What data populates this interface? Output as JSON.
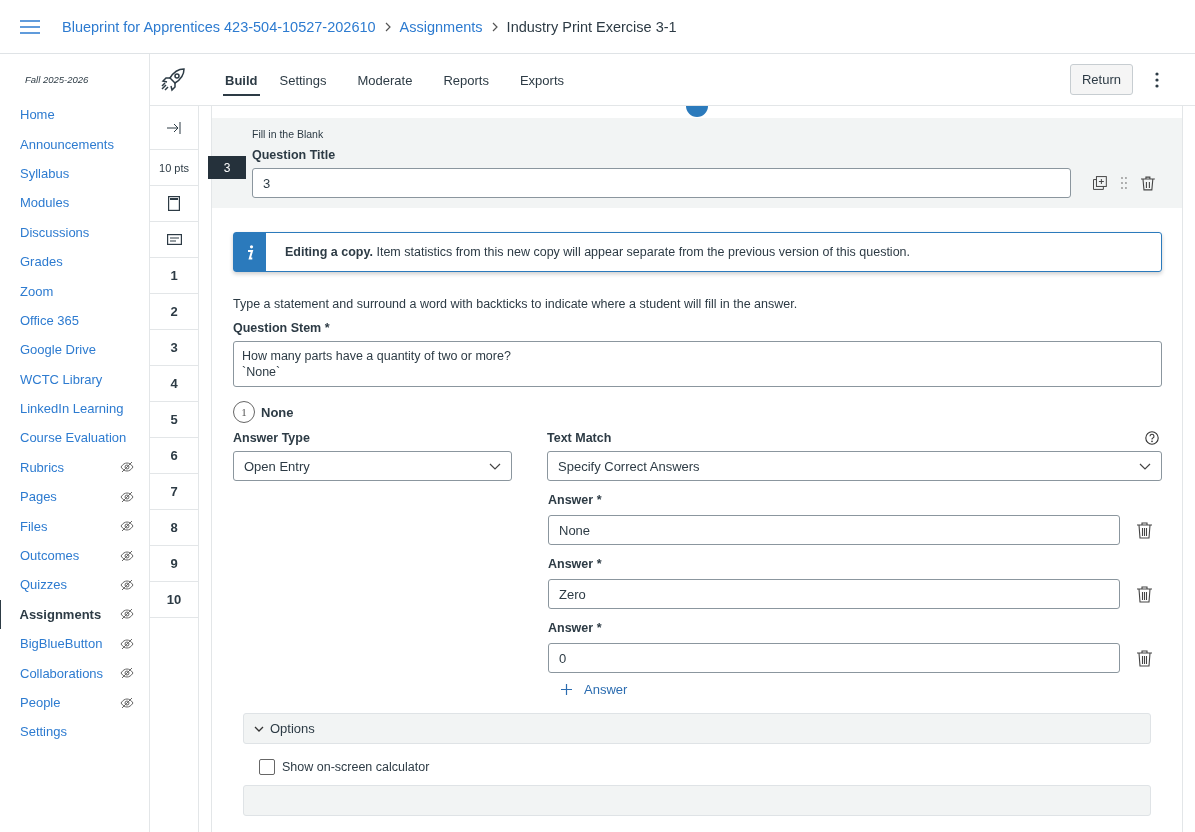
{
  "header": {
    "breadcrumbs": [
      {
        "label": "Blueprint for Apprentices 423-504-10527-202610",
        "kind": "link"
      },
      {
        "label": "Assignments",
        "kind": "link"
      },
      {
        "label": "Industry Print Exercise 3-1",
        "kind": "current"
      }
    ]
  },
  "sidebar": {
    "term": "Fall 2025-2026",
    "items": [
      {
        "label": "Home",
        "hidden": false,
        "selected": false
      },
      {
        "label": "Announcements",
        "hidden": false,
        "selected": false
      },
      {
        "label": "Syllabus",
        "hidden": false,
        "selected": false
      },
      {
        "label": "Modules",
        "hidden": false,
        "selected": false
      },
      {
        "label": "Discussions",
        "hidden": false,
        "selected": false
      },
      {
        "label": "Grades",
        "hidden": false,
        "selected": false
      },
      {
        "label": "Zoom",
        "hidden": false,
        "selected": false
      },
      {
        "label": "Office 365",
        "hidden": false,
        "selected": false
      },
      {
        "label": "Google Drive",
        "hidden": false,
        "selected": false
      },
      {
        "label": "WCTC Library",
        "hidden": false,
        "selected": false
      },
      {
        "label": "LinkedIn Learning",
        "hidden": false,
        "selected": false
      },
      {
        "label": "Course Evaluation",
        "hidden": false,
        "selected": false
      },
      {
        "label": "Rubrics",
        "hidden": true,
        "selected": false
      },
      {
        "label": "Pages",
        "hidden": true,
        "selected": false
      },
      {
        "label": "Files",
        "hidden": true,
        "selected": false
      },
      {
        "label": "Outcomes",
        "hidden": true,
        "selected": false
      },
      {
        "label": "Quizzes",
        "hidden": true,
        "selected": false
      },
      {
        "label": "Assignments",
        "hidden": true,
        "selected": true
      },
      {
        "label": "BigBlueButton",
        "hidden": true,
        "selected": false
      },
      {
        "label": "Collaborations",
        "hidden": true,
        "selected": false
      },
      {
        "label": "People",
        "hidden": true,
        "selected": false
      },
      {
        "label": "Settings",
        "hidden": false,
        "selected": false
      }
    ]
  },
  "toolbar": {
    "tabs": [
      {
        "label": "Build",
        "selected": true
      },
      {
        "label": "Settings",
        "selected": false
      },
      {
        "label": "Moderate",
        "selected": false
      },
      {
        "label": "Reports",
        "selected": false
      },
      {
        "label": "Exports",
        "selected": false
      }
    ],
    "return_button": "Return"
  },
  "rail": {
    "points": "10 pts",
    "questions": [
      {
        "label": "1",
        "selected": false
      },
      {
        "label": "2",
        "selected": false
      },
      {
        "label": "3",
        "selected": false
      },
      {
        "label": "4",
        "selected": false
      },
      {
        "label": "5",
        "selected": false
      },
      {
        "label": "6",
        "selected": false
      },
      {
        "label": "7",
        "selected": false
      },
      {
        "label": "8",
        "selected": false
      },
      {
        "label": "9",
        "selected": false
      },
      {
        "label": "10",
        "selected": false
      }
    ]
  },
  "question": {
    "number": "3",
    "type": "Fill in the Blank",
    "title_label": "Question Title",
    "title_value": "3",
    "notice": "**Editing a copy.** Item statistics from this new copy will appear separate from the previous version of this question.",
    "instructions": "Type a statement and surround a word with backticks to indicate where a student will fill in the answer.",
    "stem_label": "Question Stem *",
    "stem_lines": [
      "How many parts have a quantity of two or more?",
      "`None`"
    ],
    "blank": {
      "number": "1",
      "label": "None"
    },
    "answer_type": {
      "label": "Answer Type",
      "value": "Open Entry"
    },
    "text_match": {
      "label": "Text Match",
      "value": "Specify Correct Answers"
    },
    "answers": [
      {
        "label": "Answer *",
        "value": "None"
      },
      {
        "label": "Answer *",
        "value": "Zero"
      },
      {
        "label": "Answer *",
        "value": "0"
      }
    ],
    "add_answer": "Answer",
    "options": {
      "label": "Options",
      "expanded": true
    },
    "calculator": {
      "label": "Show on-screen calculator",
      "checked": false
    }
  }
}
